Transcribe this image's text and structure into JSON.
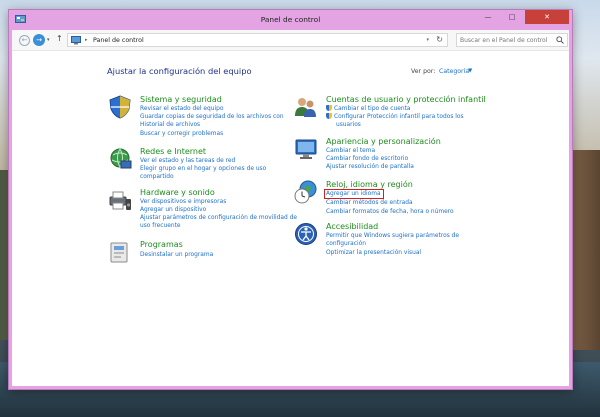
{
  "window": {
    "title": "Panel de control"
  },
  "navbar": {
    "address_text": "Panel de control",
    "search_placeholder": "Buscar en el Panel de control"
  },
  "main": {
    "heading": "Ajustar la configuración del equipo",
    "view_by_label": "Ver por:",
    "view_by_value": "Categoría"
  },
  "categories": [
    {
      "title": "Sistema y seguridad",
      "icon": "shield-system-icon",
      "links": [
        "Revisar el estado del equipo",
        "Guardar copias de seguridad de los archivos con",
        "Historial de archivos",
        "Buscar y corregir problemas"
      ]
    },
    {
      "title": "Redes e Internet",
      "icon": "network-globe-icon",
      "links": [
        "Ver el estado y las tareas de red",
        "Elegir grupo en el hogar y opciones de uso",
        "compartido"
      ]
    },
    {
      "title": "Hardware y sonido",
      "icon": "printer-speaker-icon",
      "links": [
        "Ver dispositivos e impresoras",
        "Agregar un dispositivo",
        "Ajustar parámetros de configuración de movilidad de",
        "uso frecuente"
      ]
    },
    {
      "title": "Programas",
      "icon": "programs-icon",
      "links": [
        "Desinstalar un programa"
      ]
    },
    {
      "title": "Cuentas de usuario y protección infantil",
      "icon": "users-icon",
      "links": [
        "Cambiar el tipo de cuenta",
        "Configurar Protección infantil para todos los",
        "usuarios"
      ]
    },
    {
      "title": "Apariencia y personalización",
      "icon": "appearance-icon",
      "links": [
        "Cambiar el tema",
        "Cambiar fondo de escritorio",
        "Ajustar resolución de pantalla"
      ]
    },
    {
      "title": "Reloj, idioma y región",
      "icon": "clock-globe-icon",
      "links": [
        "Agregar un idioma",
        "Cambiar métodos de entrada",
        "Cambiar formatos de fecha, hora o número"
      ]
    },
    {
      "title": "Accesibilidad",
      "icon": "accessibility-icon",
      "links": [
        "Permitir que Windows sugiera parámetros de",
        "configuración",
        "Optimizar la presentación visual"
      ]
    }
  ],
  "colors": {
    "title_bar": "#e4a4e4",
    "category_title": "#1e8b1e",
    "link": "#1e70c8",
    "heading": "#1e3287",
    "highlight": "#d02020",
    "close_button": "#c7413a"
  }
}
